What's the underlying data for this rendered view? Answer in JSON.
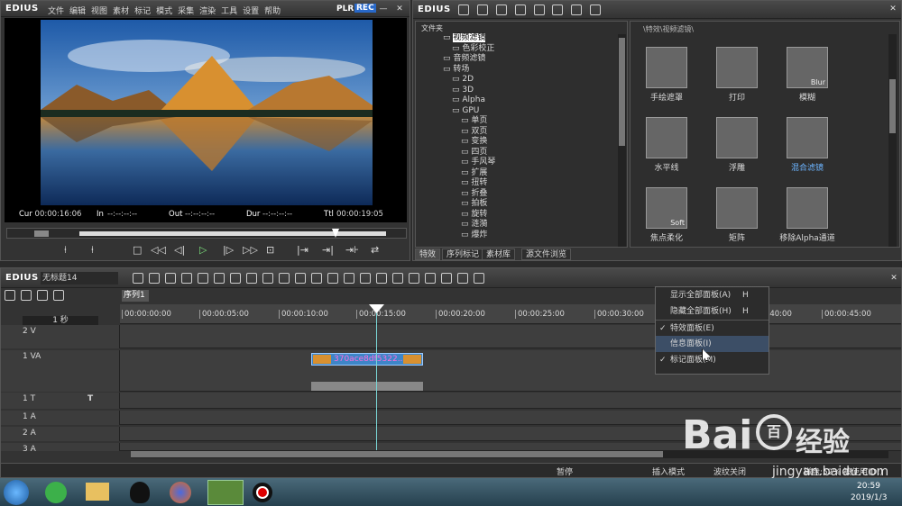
{
  "player": {
    "logo": "EDIUS",
    "menu": [
      "文件",
      "编辑",
      "视图",
      "素材",
      "标记",
      "模式",
      "采集",
      "渲染",
      "工具",
      "设置",
      "帮助"
    ],
    "plr": "PLR",
    "rec": "REC",
    "timecodes": {
      "cur_label": "Cur",
      "cur": "00:00:16:06",
      "in_label": "In",
      "in": "--:--:--:--",
      "out_label": "Out",
      "out": "--:--:--:--",
      "dur_label": "Dur",
      "dur": "--:--:--:--",
      "ttl_label": "Ttl",
      "ttl": "00:00:19:05"
    }
  },
  "bin": {
    "logo": "EDIUS",
    "folder_header": "文件夹",
    "path": "\\特效\\视频滤镜\\",
    "tree": [
      "视频滤镜",
      "色彩校正",
      "音频滤镜",
      "转场",
      "2D",
      "3D",
      "Alpha",
      "GPU",
      "单页",
      "双页",
      "变换",
      "四页",
      "手风琴",
      "扩展",
      "扭转",
      "折叠",
      "拍板",
      "旋转",
      "涟漪",
      "爆炸"
    ],
    "effects": [
      "手绘遮罩",
      "打印",
      "模糊",
      "水平线",
      "浮雕",
      "混合滤镜",
      "焦点柔化",
      "矩阵",
      "移除Alpha通道"
    ],
    "effect_overlays": {
      "blur": "Blur",
      "soft": "Soft"
    },
    "tabs": [
      "特效",
      "序列标记",
      "素材库",
      "源文件浏览"
    ]
  },
  "timeline": {
    "logo": "EDIUS",
    "project": "无标题14",
    "sequence_tab": "序列1",
    "scale": "1 秒",
    "ruler": [
      "00:00:00:00",
      "00:00:05:00",
      "00:00:10:00",
      "00:00:15:00",
      "00:00:20:00",
      "00:00:25:00",
      "00:00:30:00",
      "00:00:40:00",
      "00:00:45:00"
    ],
    "tracks": [
      {
        "name": "2 V"
      },
      {
        "name": "1 VA"
      },
      {
        "name": "1 T",
        "icon": "T"
      },
      {
        "name": "1 A"
      },
      {
        "name": "2 A"
      },
      {
        "name": "3 A"
      }
    ],
    "clip": "370ace8df5322..."
  },
  "context_menu": [
    {
      "label": "显示全部面板(A)",
      "key": "H",
      "checked": false
    },
    {
      "label": "隐藏全部面板(H)",
      "key": "H",
      "checked": false
    },
    {
      "label": "特效面板(E)",
      "key": "",
      "checked": true
    },
    {
      "label": "信息面板(I)",
      "key": "",
      "checked": false
    },
    {
      "label": "标记面板(M)",
      "key": "",
      "checked": true
    }
  ],
  "status": {
    "pause": "暂停",
    "insert_mode": "插入模式",
    "ripple_off": "波纹关闭",
    "disk": "磁盘:52% 被使用(D:)"
  },
  "taskbar": {
    "time": "20:59",
    "date": "2019/1/3"
  },
  "watermark": {
    "brand": "Bai",
    "brand2": "百",
    "cn": "经验",
    "url": "jingyan.baidu.com"
  }
}
